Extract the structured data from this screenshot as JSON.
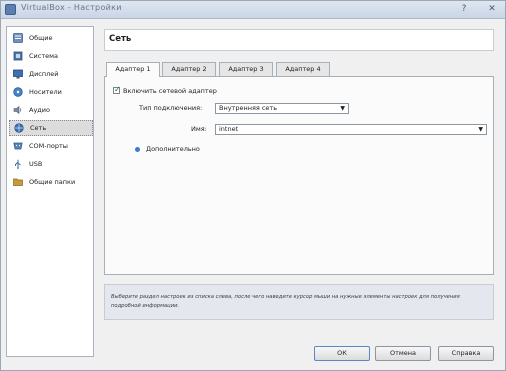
{
  "window": {
    "title": "VirtualBox - Настройки",
    "help_icon": "question-mark",
    "close_icon": "x"
  },
  "sidebar": {
    "items": [
      {
        "label": "Общие",
        "icon": "general-icon",
        "color": "#6f8fbd"
      },
      {
        "label": "Система",
        "icon": "system-icon",
        "color": "#4f76a8"
      },
      {
        "label": "Дисплей",
        "icon": "display-icon",
        "color": "#3d6fb3"
      },
      {
        "label": "Носители",
        "icon": "storage-icon",
        "color": "#4a86c6"
      },
      {
        "label": "Аудио",
        "icon": "audio-icon",
        "color": "#7b8aa0"
      },
      {
        "label": "Сеть",
        "icon": "network-icon",
        "color": "#3c74b5"
      },
      {
        "label": "COM-порты",
        "icon": "serial-port-icon",
        "color": "#5a84b7"
      },
      {
        "label": "USB",
        "icon": "usb-icon",
        "color": "#3f6ea6"
      },
      {
        "label": "Общие папки",
        "icon": "shared-folders-icon",
        "color": "#c79a3a"
      }
    ],
    "selected_index": 5
  },
  "header": {
    "title": "Сеть"
  },
  "tabs": [
    {
      "label": "Адаптер 1",
      "active": true
    },
    {
      "label": "Адаптер 2",
      "active": false
    },
    {
      "label": "Адаптер 3",
      "active": false
    },
    {
      "label": "Адаптер 4",
      "active": false
    }
  ],
  "adapter": {
    "enable_label": "Включить сетевой адаптер",
    "enabled": true,
    "attachment_label": "Тип подключения:",
    "attachment_value": "Внутренняя сеть",
    "name_label": "Имя:",
    "name_value": "intnet",
    "advanced_label": "Дополнительно"
  },
  "info": {
    "text": "Выберите раздел настроек из списка слева, после чего наведите курсор мыши на нужные элементы настроек для получения подробной информации."
  },
  "buttons": {
    "ok": "ОК",
    "cancel": "Отмена",
    "help": "Справка"
  }
}
